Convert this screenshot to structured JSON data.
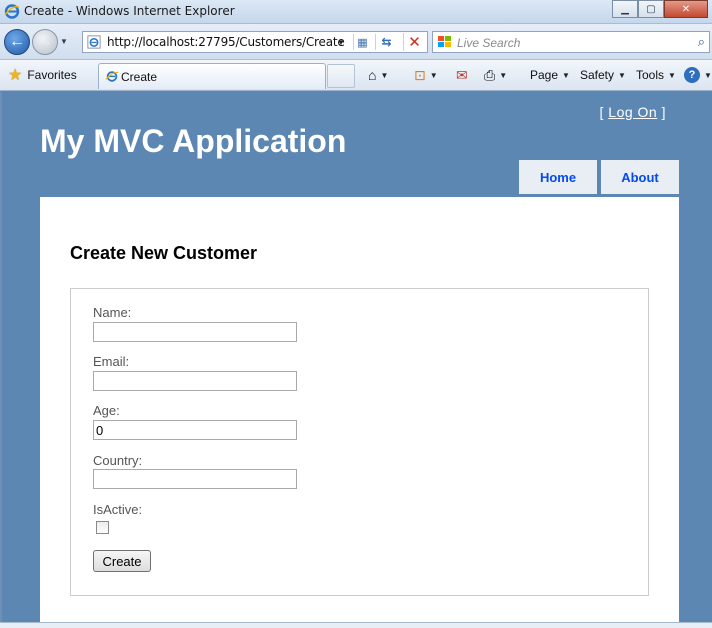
{
  "window": {
    "title": "Create - Windows Internet Explorer",
    "minimize_icon": "minimize-icon",
    "maximize_icon": "maximize-icon",
    "close_label": "✕"
  },
  "address_bar": {
    "url": "http://localhost:27795/Customers/Create",
    "search_placeholder": "Live Search"
  },
  "command_bar": {
    "favorites_label": "Favorites",
    "tab_label": "Create",
    "page_label": "Page",
    "safety_label": "Safety",
    "tools_label": "Tools",
    "help_label": "?"
  },
  "site": {
    "logon_open": "[",
    "logon_link": "Log On",
    "logon_close": "]",
    "title": "My MVC Application",
    "menu": [
      {
        "label": "Home"
      },
      {
        "label": "About"
      }
    ]
  },
  "form": {
    "heading": "Create New Customer",
    "fields": [
      {
        "label": "Name:",
        "value": ""
      },
      {
        "label": "Email:",
        "value": ""
      },
      {
        "label": "Age:",
        "value": "0"
      },
      {
        "label": "Country:",
        "value": ""
      }
    ],
    "isactive_label": "IsActive:",
    "isactive_checked": false,
    "submit_label": "Create"
  }
}
